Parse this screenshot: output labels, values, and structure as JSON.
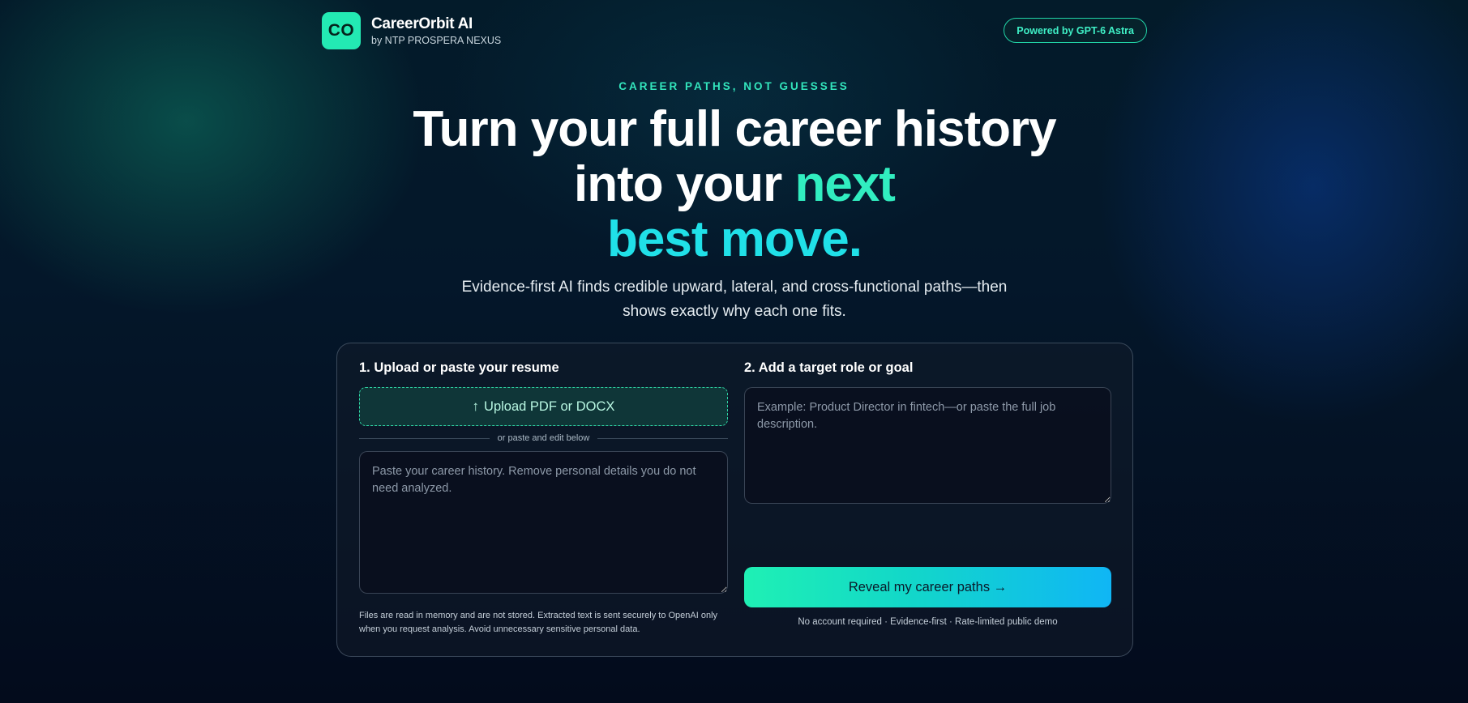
{
  "header": {
    "logo_text": "CO",
    "brand_name": "CareerOrbit AI",
    "brand_sub": "by NTP PROSPERA NEXUS",
    "powered_badge": "Powered by GPT-6 Astra"
  },
  "hero": {
    "eyebrow": "CAREER PATHS, NOT GUESSES",
    "headline_part1": "Turn your full career history into your ",
    "headline_accent1": "next",
    "headline_accent2": "best move.",
    "subhead": "Evidence-first AI finds credible upward, lateral, and cross-functional paths—then shows exactly why each one fits."
  },
  "form": {
    "step1_title": "1. Upload or paste your resume",
    "upload_label": "Upload PDF or DOCX",
    "upload_icon": "up-arrow-icon",
    "divider_text": "or paste and edit below",
    "resume_placeholder": "Paste your career history. Remove personal details you do not need analyzed.",
    "resume_value": "",
    "disclaimer": "Files are read in memory and are not stored. Extracted text is sent securely to OpenAI only when you request analysis. Avoid unnecessary sensitive personal data.",
    "step2_title": "2. Add a target role or goal",
    "target_placeholder": "Example: Product Director in fintech—or paste the full job description.",
    "target_value": "",
    "submit_label": "Reveal my career paths →",
    "footnote": "No account required · Evidence-first · Rate-limited public demo"
  },
  "colors": {
    "accent_green": "#23eab3",
    "accent_cyan": "#20e0e8",
    "button_gradient_start": "#1ff0b4",
    "button_gradient_end": "#10b6f5",
    "background": "#031b2a"
  }
}
